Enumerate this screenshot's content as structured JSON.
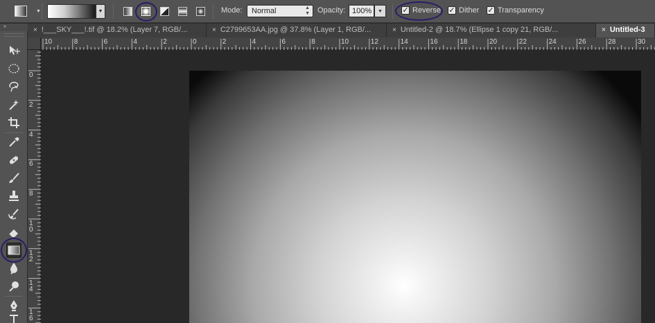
{
  "options_bar": {
    "mode_label": "Mode:",
    "mode_value": "Normal",
    "opacity_label": "Opacity:",
    "opacity_value": "100%",
    "reverse_label": "Reverse",
    "reverse_checked": true,
    "dither_label": "Dither",
    "dither_checked": true,
    "transparency_label": "Transparency",
    "transparency_checked": true,
    "gradient_types": [
      "linear-gradient-icon",
      "radial-gradient-icon",
      "angle-gradient-icon",
      "reflected-gradient-icon",
      "diamond-gradient-icon"
    ],
    "selected_gradient_type": "radial-gradient-icon",
    "highlight_color": "#2b1a6b"
  },
  "tabs": [
    {
      "label": "!___SKY___!.tif @ 18.2% (Layer 7, RGB/...",
      "close": "×",
      "active": false
    },
    {
      "label": "C2799653AA.jpg @ 37.8% (Layer 1, RGB/...",
      "close": "×",
      "active": false
    },
    {
      "label": "Untitled-2 @ 18.7% (Ellipse 1 copy 21, RGB/...",
      "close": "×",
      "active": false
    },
    {
      "label": "Untitled-3",
      "close": "×",
      "active": true
    }
  ],
  "toolbar": {
    "collapse_glyph": "»",
    "tools": [
      "move-tool-icon",
      "marquee-tool-icon",
      "lasso-tool-icon",
      "magic-wand-tool-icon",
      "crop-tool-icon",
      "eyedropper-tool-icon",
      "healing-brush-tool-icon",
      "brush-tool-icon",
      "clone-stamp-tool-icon",
      "history-brush-tool-icon",
      "eraser-tool-icon",
      "gradient-tool-icon",
      "blur-tool-icon",
      "dodge-tool-icon",
      "pen-tool-icon"
    ],
    "selected_tool": "gradient-tool-icon"
  },
  "ruler_h": [
    "10",
    "8",
    "6",
    "4",
    "2",
    "0",
    "2",
    "4",
    "6",
    "8",
    "10",
    "12",
    "14",
    "16",
    "18",
    "20",
    "22",
    "24",
    "26",
    "28",
    "30"
  ],
  "ruler_v": [
    [
      "0"
    ],
    [
      "2"
    ],
    [
      "4"
    ],
    [
      "6"
    ],
    [
      "8"
    ],
    [
      "1",
      "0"
    ],
    [
      "1",
      "2"
    ],
    [
      "1",
      "4"
    ],
    [
      "1",
      "6"
    ]
  ]
}
